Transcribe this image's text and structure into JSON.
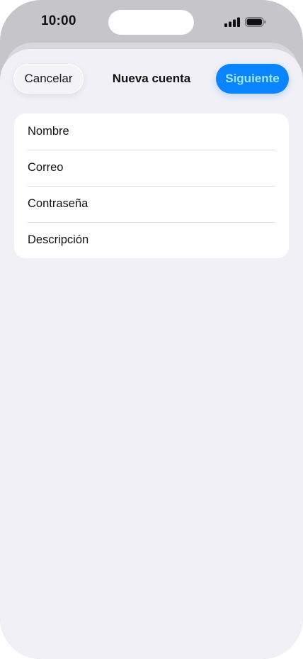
{
  "status_bar": {
    "time": "10:00"
  },
  "header": {
    "cancel_label": "Cancelar",
    "title": "Nueva cuenta",
    "next_label": "Siguiente"
  },
  "form": {
    "fields": [
      {
        "placeholder": "Nombre",
        "value": ""
      },
      {
        "placeholder": "Correo",
        "value": ""
      },
      {
        "placeholder": "Contraseña",
        "value": ""
      },
      {
        "placeholder": "Descripción",
        "value": ""
      }
    ]
  },
  "colors": {
    "accent": "#0a84ff",
    "accent_text": "#9be8ff",
    "sheet_background": "#f1f0f6",
    "card_background": "#ffffff"
  },
  "icons": [
    "cellular-signal-icon",
    "battery-icon"
  ]
}
